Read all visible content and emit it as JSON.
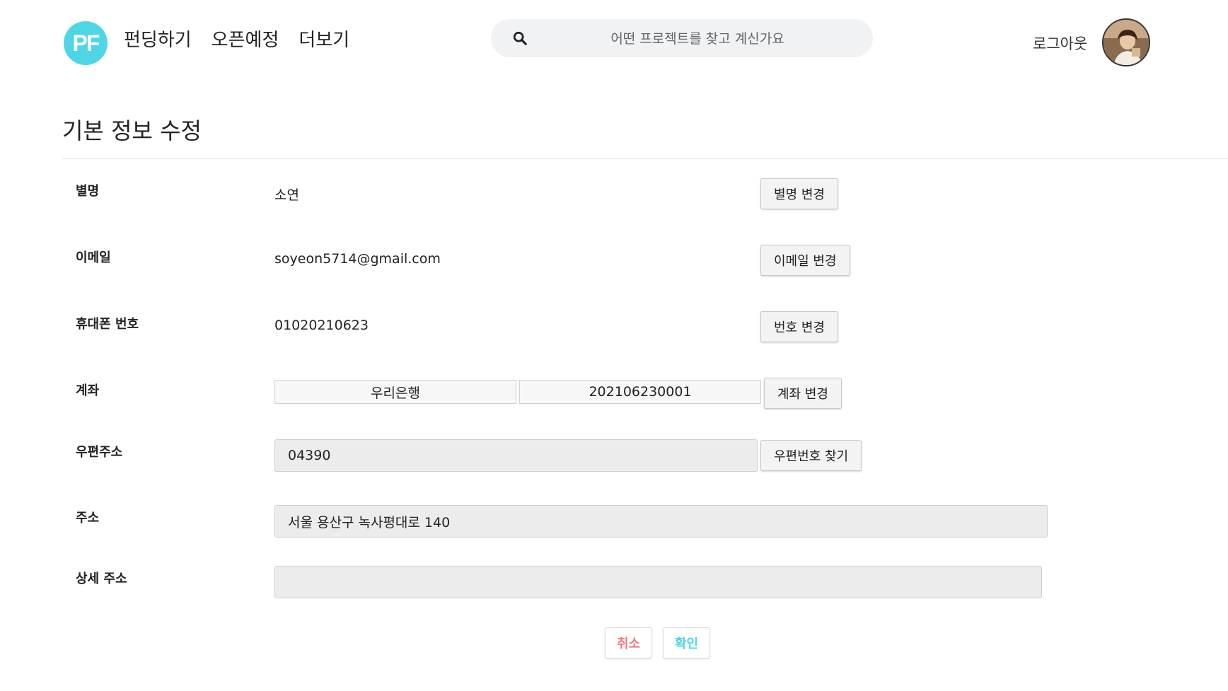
{
  "header": {
    "logo_text": "PF",
    "nav": [
      "펀딩하기",
      "오픈예정",
      "더보기"
    ],
    "search_placeholder": "어떤 프로젝트를 찾고 계신가요",
    "logout_label": "로그아웃"
  },
  "page_title": "기본 정보 수정",
  "form": {
    "nickname": {
      "label": "별명",
      "value": "소연",
      "button": "별명 변경"
    },
    "email": {
      "label": "이메일",
      "value": "soyeon5714@gmail.com",
      "button": "이메일 변경"
    },
    "phone": {
      "label": "휴대폰 번호",
      "value": "01020210623",
      "button": "번호 변경"
    },
    "account": {
      "label": "계좌",
      "bank": "우리은행",
      "number": "202106230001",
      "button": "계좌 변경"
    },
    "postal": {
      "label": "우편주소",
      "value": "04390",
      "button": "우편번호 찾기"
    },
    "address": {
      "label": "주소",
      "value": "서울 용산구 녹사평대로 140"
    },
    "detail_address": {
      "label": "상세 주소",
      "value": ""
    }
  },
  "actions": {
    "cancel": "취소",
    "confirm": "확인"
  },
  "colors": {
    "accent": "#4fd6e6",
    "cancel": "#f07b7b",
    "confirm": "#4fd6e6"
  }
}
